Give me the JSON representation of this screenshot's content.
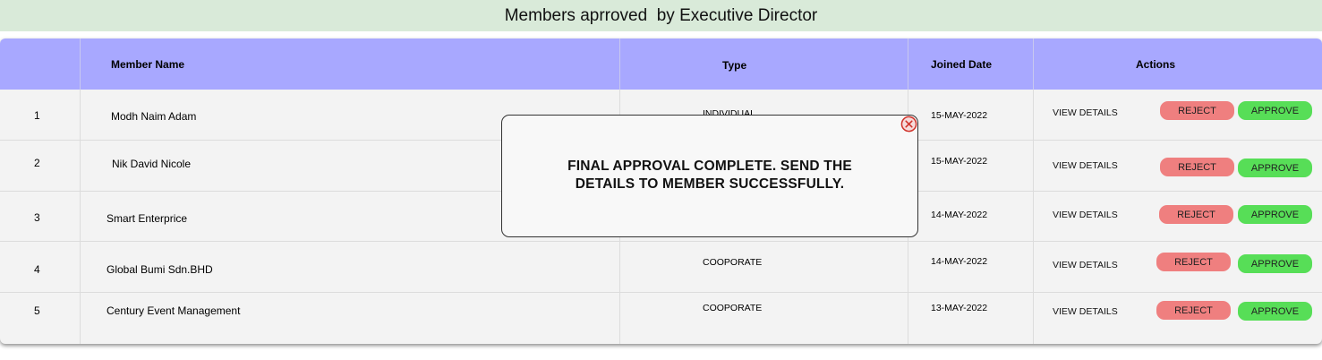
{
  "page": {
    "title": "Members aprroved  by Executive Director"
  },
  "table": {
    "headers": {
      "index": "",
      "member_name": "Member Name",
      "type": "Type",
      "joined_date": "Joined Date",
      "actions": "Actions"
    },
    "rows": [
      {
        "index": "1",
        "name": "Modh Naim Adam",
        "type": "INDIVIDUAL",
        "date": "15-MAY-2022",
        "view": "VIEW DETAILS",
        "reject": "REJECT",
        "approve": "APPROVE"
      },
      {
        "index": "2",
        "name": "Nik David Nicole",
        "type": "",
        "date": "15-MAY-2022",
        "view": "VIEW DETAILS",
        "reject": "REJECT",
        "approve": "APPROVE"
      },
      {
        "index": "3",
        "name": "Smart Enterprice",
        "type": "",
        "date": "14-MAY-2022",
        "view": "VIEW DETAILS",
        "reject": "REJECT",
        "approve": "APPROVE"
      },
      {
        "index": "4",
        "name": "Global Bumi Sdn.BHD",
        "type": "COOPORATE",
        "date": "14-MAY-2022",
        "view": "VIEW DETAILS",
        "reject": "REJECT",
        "approve": "APPROVE"
      },
      {
        "index": "5",
        "name": "Century Event Management",
        "type": "COOPORATE",
        "date": "13-MAY-2022",
        "view": "VIEW DETAILS",
        "reject": "REJECT",
        "approve": "APPROVE"
      }
    ]
  },
  "modal": {
    "message": "FINAL APPROVAL COMPLETE. SEND THE DETAILS TO MEMBER SUCCESSFULLY.",
    "close_icon": "close-circle-icon"
  },
  "colors": {
    "title_bg": "#d9ead9",
    "header_bg": "#a8a8ff",
    "reject": "#ef7f7f",
    "approve": "#57de57",
    "close": "#d0342c"
  }
}
